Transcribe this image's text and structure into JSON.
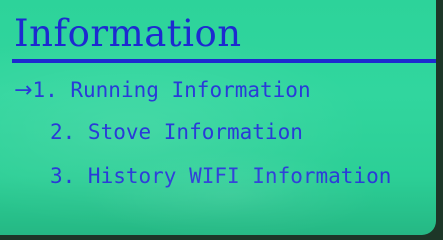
{
  "screen": {
    "title": "Information",
    "selection_arrow": "→",
    "menu": [
      {
        "label": "1. Running Information"
      },
      {
        "label": "2. Stove Information"
      },
      {
        "label": "3. History WIFI Information"
      }
    ]
  },
  "colors": {
    "lcd_background": "#2dd39a",
    "text": "#1d2ad0"
  }
}
